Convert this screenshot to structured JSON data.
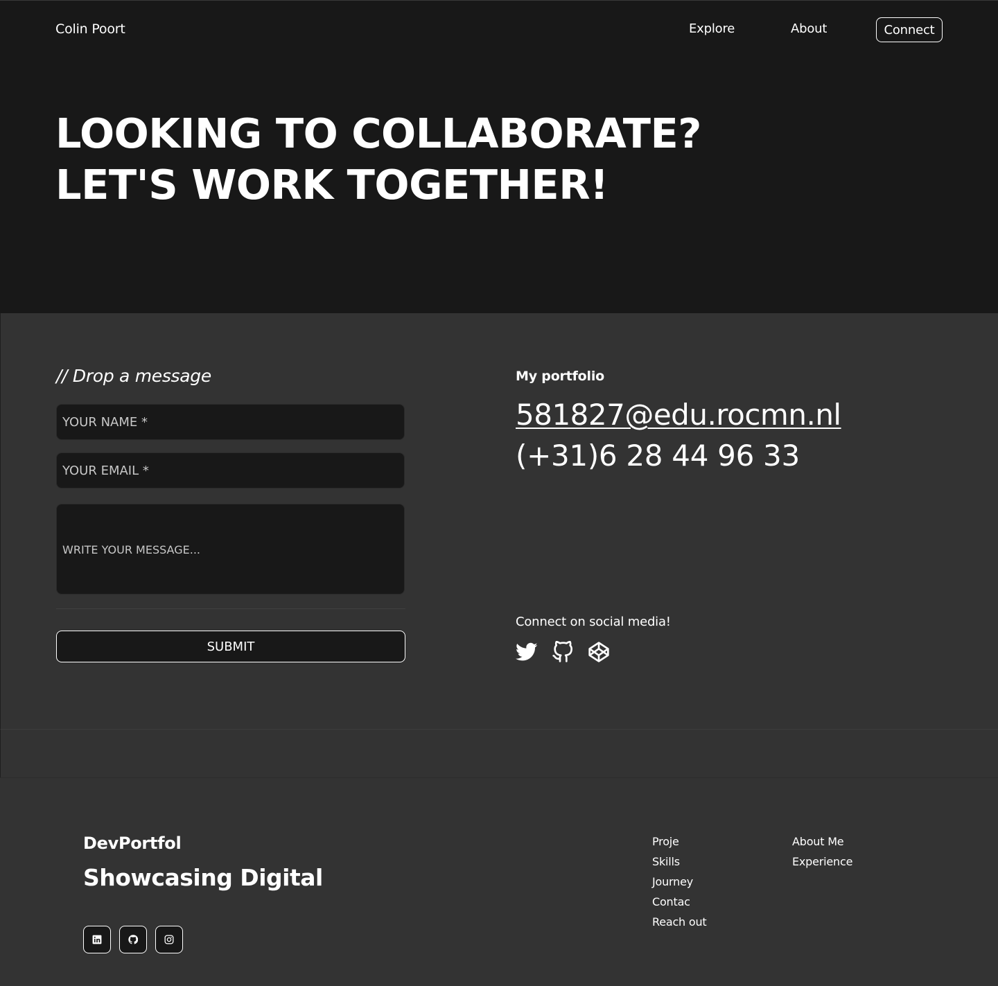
{
  "header": {
    "brand": "Colin Poort",
    "nav": {
      "explore": "Explore",
      "about": "About",
      "connect": "Connect"
    }
  },
  "hero": {
    "title": "LOOKING TO COLLABORATE? LET'S WORK TOGETHER!"
  },
  "contact_form": {
    "title": "// Drop a message",
    "name_placeholder": "YOUR NAME *",
    "email_placeholder": "YOUR EMAIL *",
    "message_placeholder": "WRITE YOUR MESSAGE...",
    "submit_label": "SUBMIT"
  },
  "contact_info": {
    "label": "My portfolio",
    "email": "581827@edu.rocmn.nl",
    "phone": "(+31)6 28 44 96 33",
    "social_label": "Connect on social media!",
    "social_icons": [
      "twitter-icon",
      "github-icon",
      "codepen-icon"
    ]
  },
  "footer": {
    "brand": "DevPortfol",
    "tagline": "Showcasing Digital",
    "social_icons": [
      "linkedin-icon",
      "github-icon",
      "instagram-icon"
    ],
    "links_col1": [
      "Proje",
      "Skills",
      "Journey",
      "Contac",
      "Reach out"
    ],
    "links_col2": [
      "About Me",
      "Experience"
    ]
  },
  "colors": {
    "hero_bg": "#181818",
    "section_bg": "#333333",
    "field_bg": "#181818",
    "text": "#ffffff"
  }
}
